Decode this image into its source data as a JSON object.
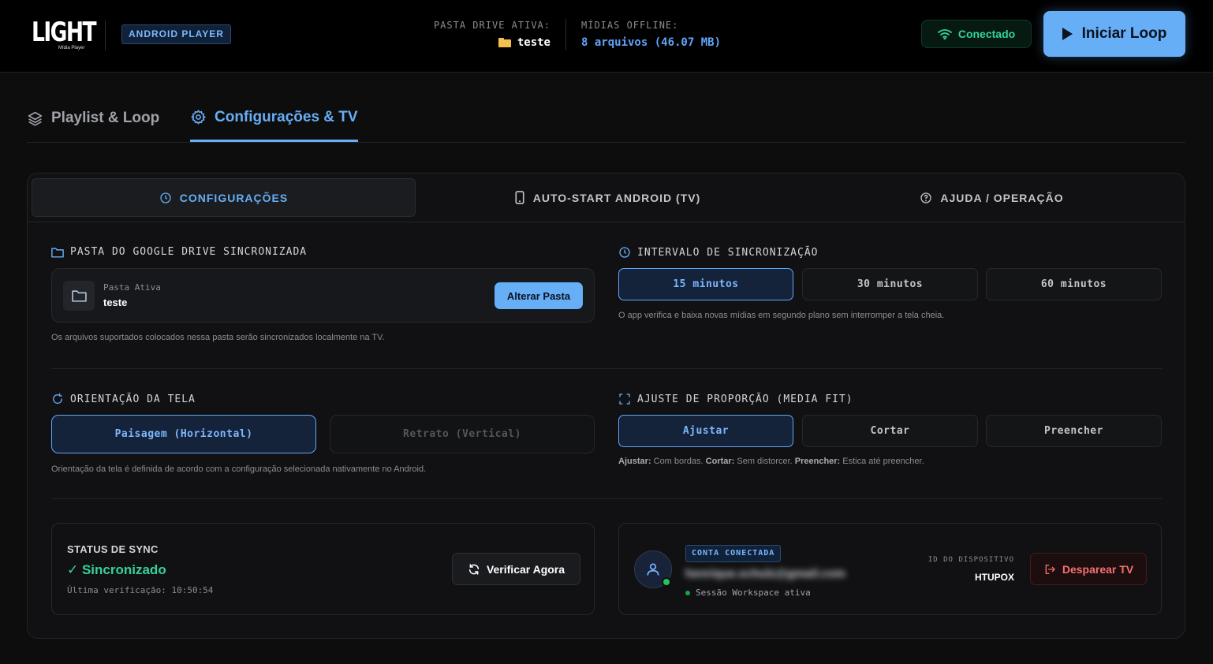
{
  "header": {
    "logo_text": "LIGHT",
    "logo_sub": "Mídia Player",
    "badge": "ANDROID PLAYER",
    "drive_label": "PASTA DRIVE ATIVA:",
    "drive_value": "teste",
    "media_label": "MÍDIAS OFFLINE:",
    "media_value": "8 arquivos (46.07 MB)",
    "status": "Conectado",
    "start_button": "Iniciar Loop"
  },
  "main_tabs": [
    {
      "label": "Playlist & Loop",
      "icon": "layers-icon"
    },
    {
      "label": "Configurações & TV",
      "icon": "gear-icon",
      "active": true
    }
  ],
  "sub_tabs": [
    {
      "label": "CONFIGURAÇÕES",
      "icon": "clock-icon",
      "active": true
    },
    {
      "label": "AUTO-START ANDROID (TV)",
      "icon": "phone-icon"
    },
    {
      "label": "AJUDA / OPERAÇÃO",
      "icon": "help-icon"
    }
  ],
  "drive_folder": {
    "title": "PASTA DO GOOGLE DRIVE SINCRONIZADA",
    "label": "Pasta Ativa",
    "value": "teste",
    "button": "Alterar Pasta",
    "help": "Os arquivos suportados colocados nessa pasta serão sincronizados localmente na TV."
  },
  "sync_interval": {
    "title": "INTERVALO DE SINCRONIZAÇÃO",
    "options": [
      "15 minutos",
      "30 minutos",
      "60 minutos"
    ],
    "selected": "15 minutos",
    "help": "O app verifica e baixa novas mídias em segundo plano sem interromper a tela cheia."
  },
  "orientation": {
    "title": "ORIENTAÇÃO DA TELA",
    "options": [
      "Paisagem (Horizontal)",
      "Retrato (Vertical)"
    ],
    "selected": "Paisagem (Horizontal)",
    "help": "Orientação da tela é definida de acordo com a configuração selecionada nativamente no Android."
  },
  "media_fit": {
    "title": "AJUSTE DE PROPORÇÃO (MEDIA FIT)",
    "options": [
      "Ajustar",
      "Cortar",
      "Preencher"
    ],
    "selected": "Ajustar",
    "help_parts": [
      {
        "b": "Ajustar:",
        "t": " Com bordas. "
      },
      {
        "b": "Cortar:",
        "t": " Sem distorcer. "
      },
      {
        "b": "Preencher:",
        "t": " Estica até preencher."
      }
    ]
  },
  "sync_status": {
    "title": "STATUS DE SYNC",
    "value": "✓ Sincronizado",
    "last_check": "Última verificação: 10:50:54",
    "button": "Verificar Agora"
  },
  "account": {
    "badge": "CONTA CONECTADA",
    "email": "henrique.schulz@gmail.com",
    "session": "Sessão Workspace ativa",
    "device_label": "ID DO DISPOSITIVO",
    "device_id": "HTUPOX",
    "button": "Desparear TV"
  },
  "colors": {
    "accent": "#66aef5",
    "success": "#34d399",
    "danger": "#f87171",
    "background": "#0d0d0e"
  }
}
